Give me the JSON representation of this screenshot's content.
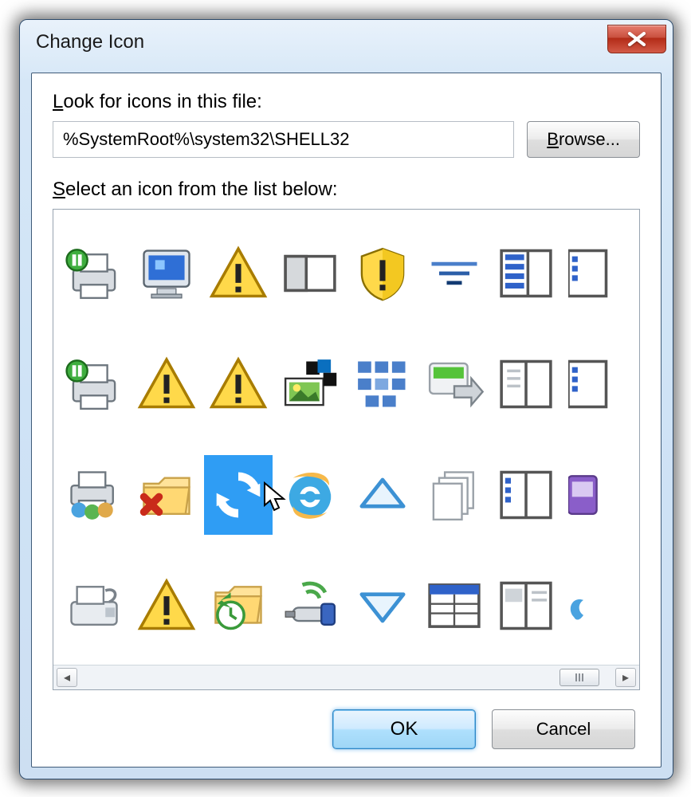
{
  "window": {
    "title": "Change Icon"
  },
  "labels": {
    "look_for": "Look for icons in this file:",
    "select_icon": "Select an icon from the list below:"
  },
  "path": {
    "value": "%SystemRoot%\\system32\\SHELL32"
  },
  "buttons": {
    "browse": "Browse...",
    "ok": "OK",
    "cancel": "Cancel"
  },
  "icons": [
    {
      "name": "printer-pause"
    },
    {
      "name": "computer-screen"
    },
    {
      "name": "warning-triangle"
    },
    {
      "name": "panel-split"
    },
    {
      "name": "security-shield-warning"
    },
    {
      "name": "filter-lines"
    },
    {
      "name": "list-view-blue"
    },
    {
      "name": "column-view-partial"
    },
    {
      "name": "printer-pause-2"
    },
    {
      "name": "warning-triangle-2"
    },
    {
      "name": "warning-triangle-3"
    },
    {
      "name": "multimedia-photos"
    },
    {
      "name": "tiles-grid"
    },
    {
      "name": "arrow-next-green"
    },
    {
      "name": "book-open"
    },
    {
      "name": "column-view-partial-2"
    },
    {
      "name": "printer-shared-users"
    },
    {
      "name": "folder-delete"
    },
    {
      "name": "refresh-sync",
      "selected": true
    },
    {
      "name": "internet-explorer"
    },
    {
      "name": "triangle-up"
    },
    {
      "name": "pages-stack"
    },
    {
      "name": "book-columns"
    },
    {
      "name": "device-purple-partial"
    },
    {
      "name": "fax-machine"
    },
    {
      "name": "warning-triangle-4"
    },
    {
      "name": "folder-history"
    },
    {
      "name": "wireless-usb"
    },
    {
      "name": "triangle-down"
    },
    {
      "name": "details-view"
    },
    {
      "name": "book-layout"
    },
    {
      "name": "link-partial"
    }
  ]
}
